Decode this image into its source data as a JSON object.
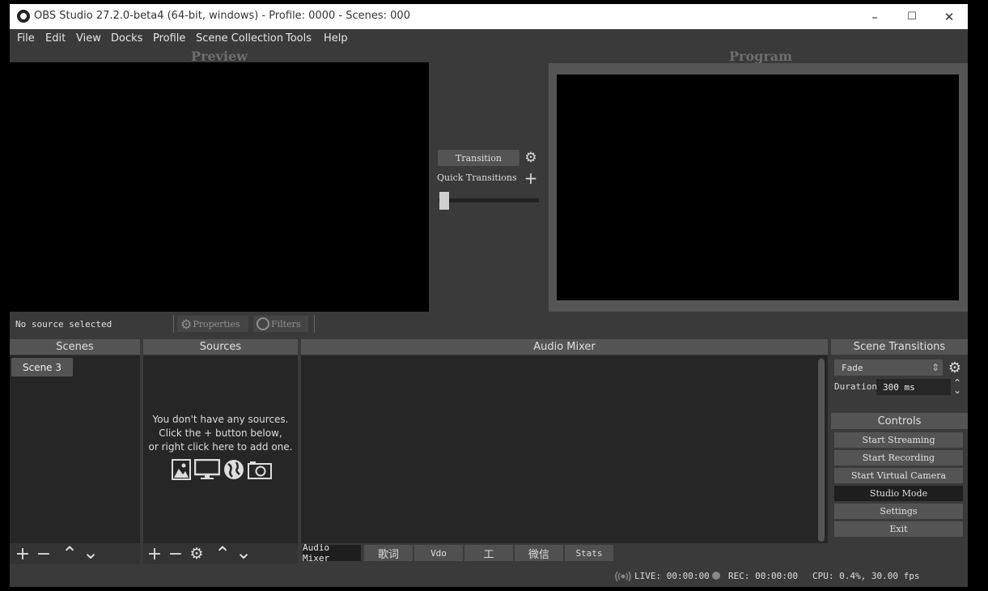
{
  "window": {
    "title": "OBS Studio 27.2.0-beta4 (64-bit, windows) - Profile: 0000 - Scenes: 000"
  },
  "menu": [
    "File",
    "Edit",
    "View",
    "Docks",
    "Profile",
    "Scene Collection",
    "Tools",
    "Help"
  ],
  "labels": {
    "preview": "Preview",
    "program": "Program",
    "no_source": "No source selected",
    "properties": "Properties",
    "filters": "Filters"
  },
  "transition": {
    "button": "Transition",
    "quick": "Quick Transitions"
  },
  "docks": {
    "scenes": "Scenes",
    "sources": "Sources",
    "audio_mixer": "Audio Mixer",
    "scene_transitions": "Scene Transitions",
    "controls": "Controls"
  },
  "scenes": [
    "Scene 3"
  ],
  "sources": {
    "empty_line1": "You don't have any sources.",
    "empty_line2": "Click the + button below,",
    "empty_line3": "or right click here to add one."
  },
  "tabs": [
    "Audio Mixer",
    "歌词",
    "Vdo",
    "工",
    "微信",
    "Stats"
  ],
  "scene_transitions": {
    "selected": "Fade",
    "duration_label": "Duration",
    "duration_value": "300 ms"
  },
  "controls": [
    "Start Streaming",
    "Start Recording",
    "Start Virtual Camera",
    "Studio Mode",
    "Settings",
    "Exit"
  ],
  "status": {
    "live": "LIVE: 00:00:00",
    "rec": "REC: 00:00:00",
    "cpu": "CPU: 0.4%, 30.00 fps"
  },
  "window_controls": {
    "minimize": "–",
    "maximize": "☐",
    "close": "✕"
  },
  "icons": {
    "plus": "+",
    "minus": "−",
    "up": "⌃",
    "down": "⌄",
    "gear": "⚙",
    "updown": "⇕"
  },
  "colors": {
    "bg": "#3a3a3a",
    "panel": "#262626",
    "button": "#545454",
    "active": "#1e1e1e"
  }
}
